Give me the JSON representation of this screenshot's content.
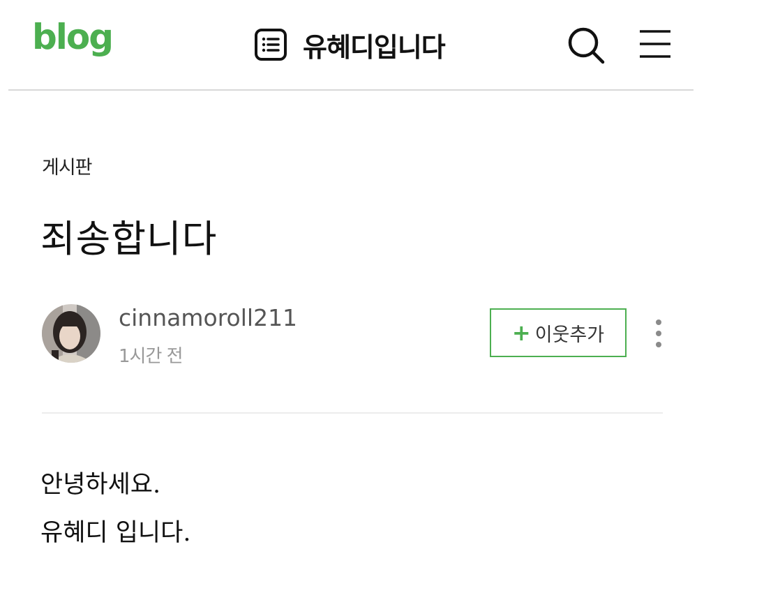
{
  "colors": {
    "brand": "#4caf50"
  },
  "header": {
    "logo": "blog",
    "logo_icon": "naver-blog-logo",
    "list_icon": "list-icon",
    "blog_title": "유혜디입니다",
    "search_icon": "search-icon",
    "menu_icon": "hamburger-menu-icon"
  },
  "post": {
    "category": "게시판",
    "title": "죄송합니다",
    "author": {
      "avatar_icon": "avatar",
      "name": "cinnamoroll211",
      "time": "1시간 전"
    },
    "add_neighbor": {
      "icon": "plus-icon",
      "plus": "+",
      "label": "이웃추가"
    },
    "more_icon": "more-vertical-icon",
    "body": [
      "안녕하세요.",
      "유혜디 입니다."
    ]
  }
}
